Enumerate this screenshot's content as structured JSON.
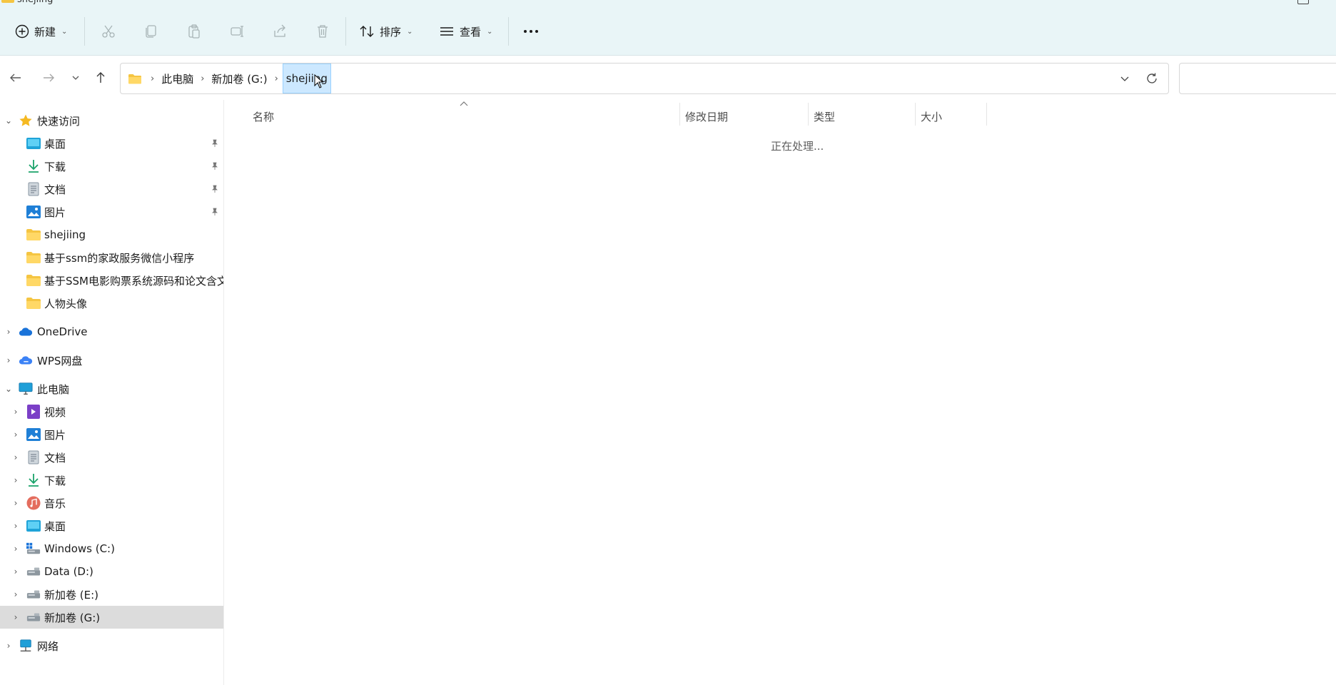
{
  "window": {
    "title": "shejiing"
  },
  "toolbar": {
    "new_label": "新建",
    "sort_label": "排序",
    "view_label": "查看",
    "icons": [
      "cut-icon",
      "copy-icon",
      "paste-icon",
      "rename-icon",
      "share-icon",
      "delete-icon",
      "more-icon"
    ]
  },
  "address": {
    "breadcrumbs": [
      "此电脑",
      "新加卷 (G:)",
      "shejiing"
    ]
  },
  "sidebar": {
    "quick_access": {
      "label": "快速访问",
      "items": [
        {
          "label": "桌面",
          "icon": "desktop-icon",
          "pinned": true
        },
        {
          "label": "下载",
          "icon": "download-icon",
          "pinned": true
        },
        {
          "label": "文档",
          "icon": "document-icon",
          "pinned": true
        },
        {
          "label": "图片",
          "icon": "pictures-icon",
          "pinned": true
        },
        {
          "label": "shejiing",
          "icon": "folder-icon",
          "pinned": false
        },
        {
          "label": "基于ssm的家政服务微信小程序",
          "icon": "folder-icon",
          "pinned": false
        },
        {
          "label": "基于SSM电影购票系统源码和论文含文",
          "icon": "folder-icon",
          "pinned": false
        },
        {
          "label": "人物头像",
          "icon": "folder-icon",
          "pinned": false
        }
      ]
    },
    "onedrive": {
      "label": "OneDrive"
    },
    "wps": {
      "label": "WPS网盘"
    },
    "this_pc": {
      "label": "此电脑",
      "items": [
        {
          "label": "视频",
          "icon": "video-icon"
        },
        {
          "label": "图片",
          "icon": "pictures-icon"
        },
        {
          "label": "文档",
          "icon": "document-icon"
        },
        {
          "label": "下载",
          "icon": "download-icon"
        },
        {
          "label": "音乐",
          "icon": "music-icon"
        },
        {
          "label": "桌面",
          "icon": "desktop-icon"
        },
        {
          "label": "Windows (C:)",
          "icon": "windows-drive-icon"
        },
        {
          "label": "Data (D:)",
          "icon": "drive-icon"
        },
        {
          "label": "新加卷 (E:)",
          "icon": "drive-icon"
        },
        {
          "label": "新加卷 (G:)",
          "icon": "drive-icon",
          "selected": true
        }
      ]
    },
    "network": {
      "label": "网络"
    }
  },
  "filelist": {
    "columns": [
      "名称",
      "修改日期",
      "类型",
      "大小"
    ],
    "status": "正在处理..."
  },
  "colors": {
    "toolbar_bg": "#e9f5f7",
    "selection": "#cce8ff",
    "sidebar_selected": "#dcdcdc",
    "folder_yellow": "#f5c542"
  }
}
